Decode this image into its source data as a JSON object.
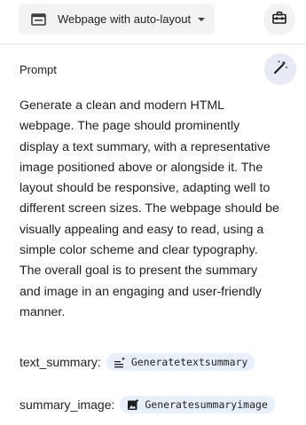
{
  "header": {
    "template_label": "Webpage with auto-layout",
    "icons": {
      "template": "layout-icon",
      "caret": "chevron-down-icon",
      "toolbox": "toolbox-icon"
    }
  },
  "prompt": {
    "heading": "Prompt",
    "magic_icon": "magic-wand-icon",
    "text": "Generate a clean and modern HTML webpage. The page should prominently display a text summary, with a representative image positioned above or alongside it. The layout should be responsive, adapting well to different screen sizes. The webpage should be visually appealing and easy to read, using a simple color scheme and clear typography. The overall goal is to present the summary and image in an engaging and user-friendly manner."
  },
  "variables": [
    {
      "name": "text_summary:",
      "chip_label": "Generatetextsummary",
      "chip_icon": "text-generate-icon"
    },
    {
      "name": "summary_image:",
      "chip_label": "Generatesummaryimage",
      "chip_icon": "image-generate-icon"
    }
  ]
}
